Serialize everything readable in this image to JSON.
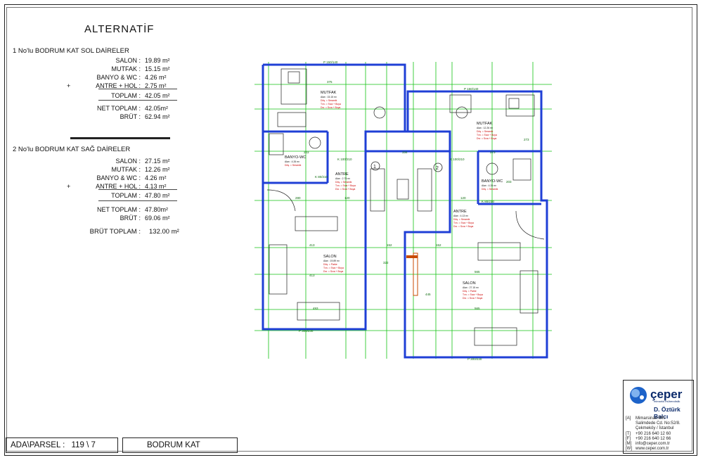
{
  "title": "ALTERNATİF",
  "sections": [
    {
      "heading": "1  No'lu BODRUM KAT SOL DAİRELER",
      "rows": [
        {
          "label": "SALON :",
          "value": "19.89 m²",
          "prefix": ""
        },
        {
          "label": "MUTFAK :",
          "value": "15.15 m²",
          "prefix": ""
        },
        {
          "label": "BANYO & WC :",
          "value": "4.26 m²",
          "prefix": ""
        },
        {
          "label": "ANTRE + HOL :",
          "value": "2.75 m²",
          "prefix": "+"
        }
      ],
      "toplam": {
        "label": "TOPLAM :",
        "value": "42.05 m²"
      },
      "net": {
        "label": "NET TOPLAM :",
        "value": "42.05m²"
      },
      "brut": {
        "label": "BRÜT :",
        "value": "62.94 m²"
      }
    },
    {
      "heading": "2  No'lu BODRUM KAT SAĞ DAİRELER",
      "rows": [
        {
          "label": "SALON :",
          "value": "27.15 m²",
          "prefix": ""
        },
        {
          "label": "MUTFAK :",
          "value": "12.26 m²",
          "prefix": ""
        },
        {
          "label": "BANYO & WC :",
          "value": "4.26 m²",
          "prefix": ""
        },
        {
          "label": "ANTRE + HOL :",
          "value": "4.13 m²",
          "prefix": "+"
        }
      ],
      "toplam": {
        "label": "TOPLAM :",
        "value": "47.80 m²"
      },
      "net": {
        "label": "NET TOPLAM :",
        "value": "47.80m²"
      },
      "brut": {
        "label": "BRÜT :",
        "value": "69.06 m²"
      }
    }
  ],
  "brut_toplam": {
    "label": "BRÜT TOPLAM :",
    "value": "132.00 m²"
  },
  "footer": {
    "ada_parsel_label": "ADA\\PARSEL :",
    "ada_parsel_value": "119 \\ 7",
    "floor": "BODRUM KAT"
  },
  "company": {
    "brand": "çeper",
    "brand_sub": "mimarlık mühendislik",
    "person": "D. Öztürk Balcı",
    "contacts": [
      {
        "key": "[A]",
        "text": "Mimarsinan Mh."
      },
      {
        "key": "",
        "text": "Salimdede Cd. No:52/8."
      },
      {
        "key": "",
        "text": "Çekmeköy / İstanbul"
      },
      {
        "key": "[T]",
        "text": "+90 216 640 12 60"
      },
      {
        "key": "[F]",
        "text": "+90 216 640 12 66"
      },
      {
        "key": "[M]",
        "text": "info@ceper.com.tr"
      },
      {
        "key": "[W]",
        "text": "www.ceper.com.tr"
      }
    ]
  },
  "plan": {
    "rooms": [
      {
        "name": "MUTFAK",
        "lines": [
          "Alan : 15.15 m²",
          "Döş. = Seramik",
          "Tvn. = Sıva + Boya",
          "Dvr. = Sıva + Boya"
        ]
      },
      {
        "name": "MUTFAK",
        "lines": [
          "Alan : 12.26 m²",
          "Döş. = Seramik",
          "Tvn. = Sıva + Boya",
          "Dvr. = Sıva + Boya"
        ]
      },
      {
        "name": "BANYO-WC",
        "lines": [
          "Alan : 4.26 m²",
          "Döş. = Seramik"
        ]
      },
      {
        "name": "BANYO-WC",
        "lines": [
          "Alan : 4.26 m²",
          "Döş. = Seramik"
        ]
      },
      {
        "name": "ANTRE",
        "lines": [
          "Alan : 2.75 m²",
          "Döş. = Seramik",
          "Tvn. = Sıva + Boya",
          "Dvr. = Sıva + Boya"
        ]
      },
      {
        "name": "ANTRE",
        "lines": [
          "Alan : 4.13 m²",
          "Döş. = Seramik",
          "Tvn. = Sıva + Boya",
          "Dvr. = Sıva + Boya"
        ]
      },
      {
        "name": "SALON",
        "lines": [
          "Alan : 19.89 m²",
          "Döş. = Parke",
          "Tvn. = Sıva + Boya",
          "Dvr. = Sıva + Boya"
        ]
      },
      {
        "name": "SALON",
        "lines": [
          "Alan : 27.15 m²",
          "Döş. = Parke",
          "Tvn. = Sıva + Boya",
          "Dvr. = Sıva + Boya"
        ]
      }
    ],
    "markers": [
      "1",
      "2"
    ],
    "windows": [
      "P 150/140",
      "P 150/140",
      "P 300/230",
      "P 300/230"
    ],
    "doors": [
      "K 100/210",
      "K 100/210",
      "K 80/210",
      "K 80/210"
    ],
    "dims": [
      "375",
      "334",
      "413",
      "413",
      "493",
      "565",
      "565",
      "120",
      "120",
      "152",
      "152",
      "273",
      "273",
      "203",
      "203",
      "280",
      "322",
      "445"
    ],
    "colors": {
      "wall": "#1f3fd6",
      "green": "#14c314",
      "fixture": "#222222",
      "accent": "#c84a00"
    }
  }
}
